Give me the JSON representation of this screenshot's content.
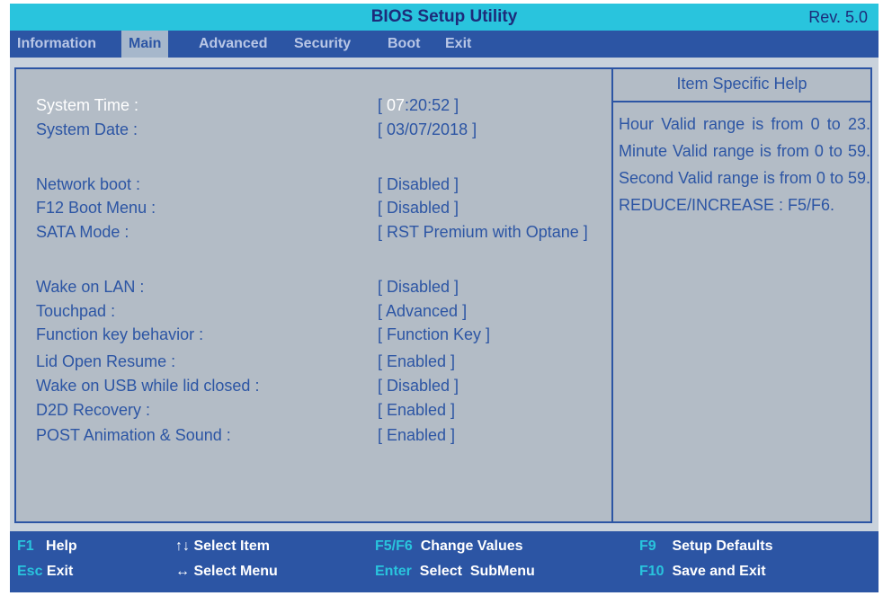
{
  "title": "BIOS Setup Utility",
  "revision": "Rev. 5.0",
  "tabs": [
    "Information",
    "Main",
    "Advanced",
    "Security",
    "Boot",
    "Exit"
  ],
  "active_tab": "Main",
  "settings": {
    "system_time": {
      "label": "System Time :",
      "open": "[ ",
      "hours": "07",
      "rest": ":20:52 ]"
    },
    "system_date": {
      "label": "System Date :",
      "value": "[ 03/07/2018 ]"
    },
    "network_boot": {
      "label": "Network boot :",
      "value": "[ Disabled ]"
    },
    "f12_boot_menu": {
      "label": "F12 Boot Menu :",
      "value": "[ Disabled ]"
    },
    "sata_mode": {
      "label": "SATA Mode :",
      "value": "[ RST Premium with Optane ]"
    },
    "wake_on_lan": {
      "label": "Wake on LAN :",
      "value": "[ Disabled ]"
    },
    "touchpad": {
      "label": "Touchpad :",
      "value": "[ Advanced ]"
    },
    "function_key_behavior": {
      "label": "Function key behavior :",
      "value": "[ Function Key ]"
    },
    "lid_open_resume": {
      "label": "Lid Open Resume :",
      "value": "[ Enabled ]"
    },
    "wake_on_usb": {
      "label": "Wake on USB while lid closed :",
      "value": "[ Disabled ]"
    },
    "d2d_recovery": {
      "label": "D2D Recovery :",
      "value": "[ Enabled ]"
    },
    "post_animation": {
      "label": "POST Animation & Sound :",
      "value": "[ Enabled ]"
    }
  },
  "help": {
    "heading": "Item Specific Help",
    "text": "Hour Valid range is from 0 to 23. Minute Valid range is from 0 to 59. Second Valid range is from 0 to 59. REDUCE/INCREASE : F5/F6."
  },
  "footer": [
    {
      "key": "F1",
      "desc": "Help"
    },
    {
      "key": "Esc",
      "desc": "Exit"
    },
    {
      "key": "↑↓",
      "desc": "Select Item"
    },
    {
      "key": "↔",
      "desc": "Select Menu"
    },
    {
      "key": "F5/F6",
      "desc": "Change Values"
    },
    {
      "key": "Enter",
      "desc": "Select  SubMenu"
    },
    {
      "key": "F9",
      "desc": "Setup Defaults"
    },
    {
      "key": "F10",
      "desc": "Save and Exit"
    }
  ],
  "colors": {
    "title_bar": "#29c4dd",
    "menu_bar": "#2c55a4",
    "panel": "#b3bcc6",
    "text": "#2c55a4",
    "highlight": "#ffffff"
  }
}
